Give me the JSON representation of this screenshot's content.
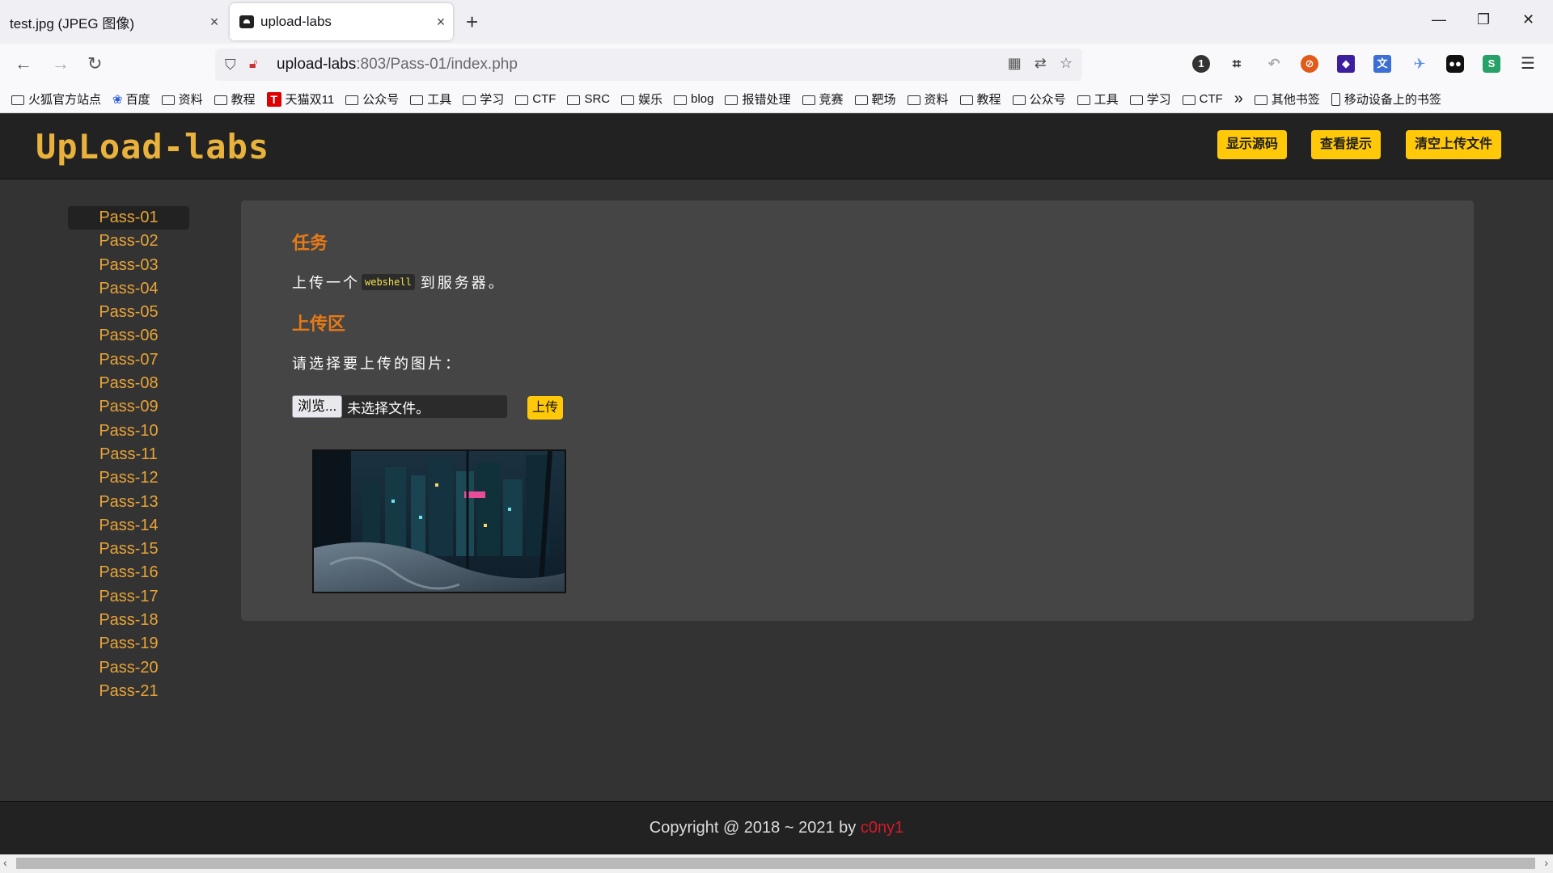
{
  "browser": {
    "tabs": [
      {
        "title": "test.jpg (JPEG 图像)",
        "active": false
      },
      {
        "title": "upload-labs",
        "active": true
      }
    ],
    "new_tab": "+",
    "close_glyph": "×",
    "window_controls": [
      "—",
      "❐",
      "✕"
    ],
    "url_host": "upload-labs",
    "url_path": ":803/Pass-01/index.php",
    "bookmarks": [
      {
        "label": "火狐官方站点",
        "icon": "folder-icon"
      },
      {
        "label": "百度",
        "icon": "paw-icon"
      },
      {
        "label": "资料",
        "icon": "folder-icon"
      },
      {
        "label": "教程",
        "icon": "folder-icon"
      },
      {
        "label": "天猫双11",
        "icon": "tmall-icon"
      },
      {
        "label": "公众号",
        "icon": "folder-icon"
      },
      {
        "label": "工具",
        "icon": "folder-icon"
      },
      {
        "label": "学习",
        "icon": "folder-icon"
      },
      {
        "label": "CTF",
        "icon": "folder-icon"
      },
      {
        "label": "SRC",
        "icon": "folder-icon"
      },
      {
        "label": "娱乐",
        "icon": "folder-icon"
      },
      {
        "label": "blog",
        "icon": "folder-icon"
      },
      {
        "label": "报错处理",
        "icon": "folder-icon"
      },
      {
        "label": "竞赛",
        "icon": "folder-icon"
      },
      {
        "label": "靶场",
        "icon": "folder-icon"
      },
      {
        "label": "资料",
        "icon": "folder-icon"
      },
      {
        "label": "教程",
        "icon": "folder-icon"
      },
      {
        "label": "公众号",
        "icon": "folder-icon"
      },
      {
        "label": "工具",
        "icon": "folder-icon"
      },
      {
        "label": "学习",
        "icon": "folder-icon"
      },
      {
        "label": "CTF",
        "icon": "folder-icon"
      }
    ],
    "bookmarks_overflow": "»",
    "bookmarks_other": "其他书签",
    "bookmarks_mobile": "移动设备上的书签"
  },
  "header": {
    "logo": "UpLoad-labs",
    "buttons": [
      "显示源码",
      "查看提示",
      "清空上传文件"
    ],
    "button_color": "#ffc90a"
  },
  "sidebar": {
    "items": [
      "Pass-01",
      "Pass-02",
      "Pass-03",
      "Pass-04",
      "Pass-05",
      "Pass-06",
      "Pass-07",
      "Pass-08",
      "Pass-09",
      "Pass-10",
      "Pass-11",
      "Pass-12",
      "Pass-13",
      "Pass-14",
      "Pass-15",
      "Pass-16",
      "Pass-17",
      "Pass-18",
      "Pass-19",
      "Pass-20",
      "Pass-21"
    ],
    "active": "Pass-01",
    "accent": "#e8a438"
  },
  "main": {
    "task_title": "任务",
    "task_prefix": "上传一个",
    "task_code": "webshell",
    "task_suffix": "到服务器。",
    "upload_title": "上传区",
    "prompt": "请选择要上传的图片：",
    "browse_label": "浏览...",
    "file_status": "未选择文件。",
    "upload_label": "上传",
    "title_color": "#e67a17"
  },
  "footer": {
    "text": "Copyright @ 2018 ~ 2021 by ",
    "author": "c0ny1",
    "author_color": "#d11a2a"
  }
}
